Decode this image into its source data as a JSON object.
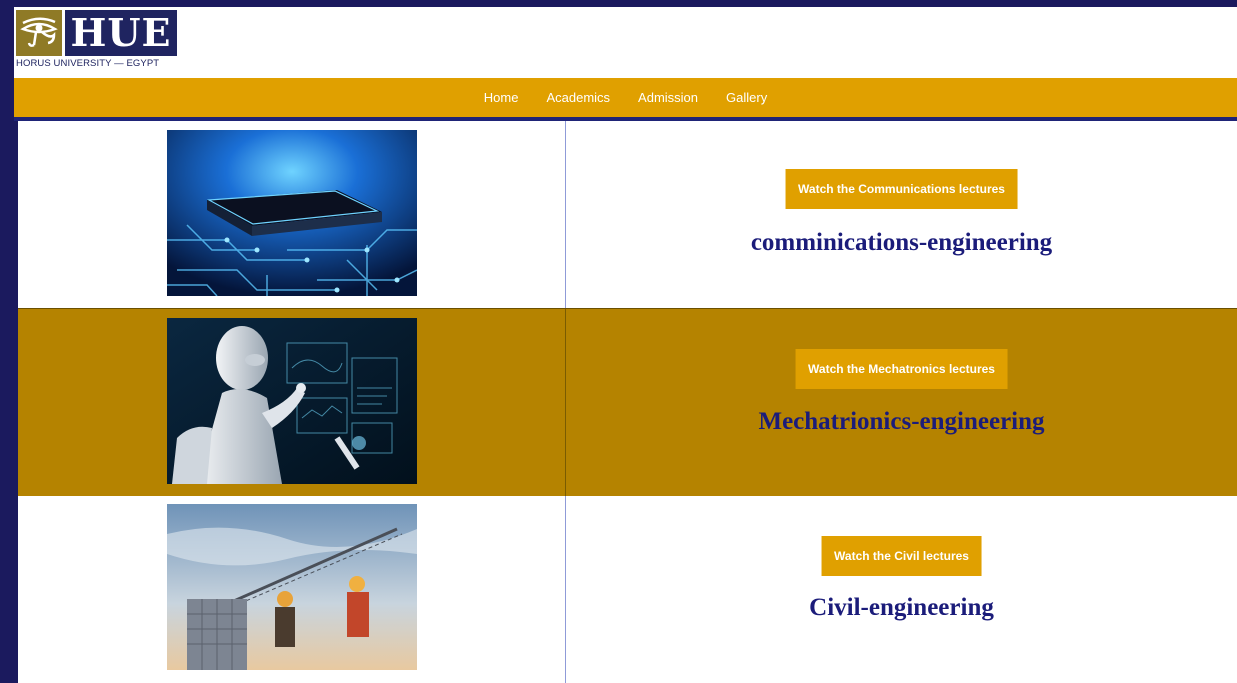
{
  "logo": {
    "text": "HUE",
    "subtitle": "HORUS UNIVERSITY — EGYPT"
  },
  "nav": {
    "items": [
      "Home",
      "Academics",
      "Admission",
      "Gallery"
    ]
  },
  "departments": [
    {
      "button_label": "Watch the Communications lectures",
      "title": "comminications-engineering",
      "image": "circuit-chip-image"
    },
    {
      "button_label": "Watch the Mechatronics lectures",
      "title": "Mechatrionics-engineering",
      "image": "robot-image"
    },
    {
      "button_label": "Watch the Civil lectures",
      "title": "Civil-engineering",
      "image": "construction-site-image"
    }
  ],
  "colors": {
    "page_background": "#1b1a5e",
    "nav_bar": "#e0a000",
    "gold_row": "#b58300",
    "title_blue": "#1b1c7a"
  }
}
